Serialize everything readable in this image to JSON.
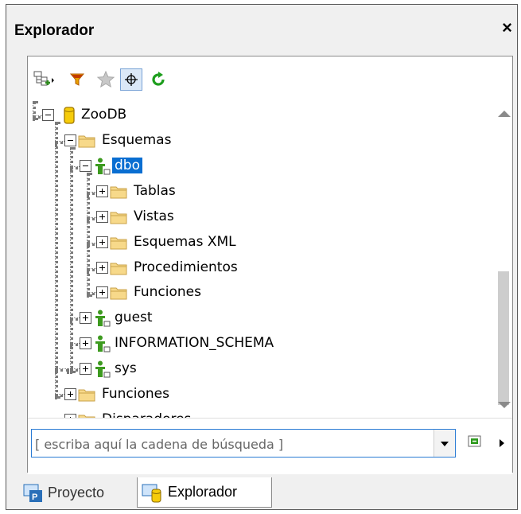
{
  "panel": {
    "title": "Explorador",
    "close_label": "×"
  },
  "toolbar": {
    "buttons": [
      {
        "name": "add-object",
        "icon": "add-object-icon"
      },
      {
        "name": "filter",
        "icon": "filter-funnel-icon"
      },
      {
        "name": "favorites",
        "icon": "star-icon"
      },
      {
        "name": "locate",
        "icon": "crosshair-icon",
        "pressed": true
      },
      {
        "name": "refresh",
        "icon": "refresh-icon"
      }
    ]
  },
  "tree": {
    "items": [
      {
        "label": "ZooDB",
        "icon": "database-icon",
        "state": "expanded"
      },
      {
        "label": "Esquemas",
        "icon": "folder-icon",
        "state": "expanded"
      },
      {
        "label": "dbo",
        "icon": "schema-user-icon",
        "state": "expanded",
        "selected": true
      },
      {
        "label": "Tablas",
        "icon": "folder-icon",
        "state": "collapsed"
      },
      {
        "label": "Vistas",
        "icon": "folder-icon",
        "state": "collapsed"
      },
      {
        "label": "Esquemas XML",
        "icon": "folder-icon",
        "state": "collapsed"
      },
      {
        "label": "Procedimientos",
        "icon": "folder-icon",
        "state": "collapsed"
      },
      {
        "label": "Funciones",
        "icon": "folder-icon",
        "state": "collapsed"
      },
      {
        "label": "guest",
        "icon": "schema-user-icon",
        "state": "collapsed"
      },
      {
        "label": "INFORMATION_SCHEMA",
        "icon": "schema-user-icon",
        "state": "collapsed"
      },
      {
        "label": "sys",
        "icon": "schema-user-icon",
        "state": "collapsed"
      },
      {
        "label": "Funciones",
        "icon": "folder-icon",
        "state": "collapsed"
      },
      {
        "label": "Disparadores",
        "icon": "folder-icon",
        "state": "collapsed"
      }
    ]
  },
  "search": {
    "placeholder": "[ escriba aquí la cadena de búsqueda ]",
    "value": ""
  },
  "tabs": [
    {
      "label": "Proyecto",
      "icon": "project-icon",
      "active": false
    },
    {
      "label": "Explorador",
      "icon": "explorer-icon",
      "active": true
    }
  ],
  "colors": {
    "selection": "#0a6ed1",
    "folder": "#f5d37a",
    "schema_user": "#3d9a1f",
    "database": "#f2c200"
  }
}
